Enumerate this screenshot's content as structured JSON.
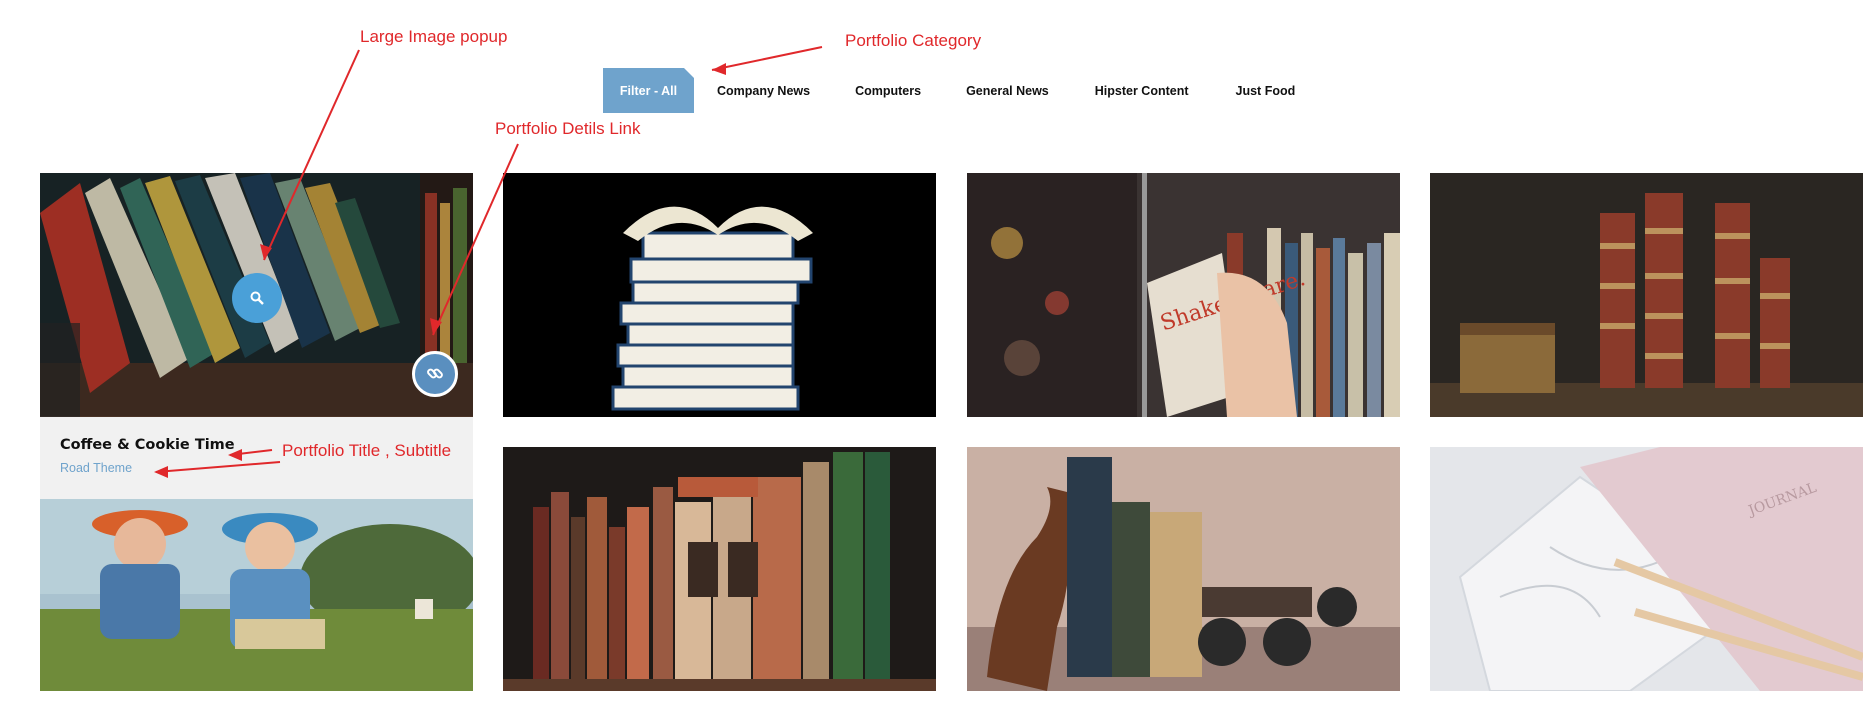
{
  "filters": {
    "items": [
      {
        "label": "Filter - All",
        "active": true
      },
      {
        "label": "Company News",
        "active": false
      },
      {
        "label": "Computers",
        "active": false
      },
      {
        "label": "General News",
        "active": false
      },
      {
        "label": "Hipster Content",
        "active": false
      },
      {
        "label": "Just Food",
        "active": false
      }
    ]
  },
  "portfolio": {
    "featured": {
      "title": "Coffee & Cookie Time",
      "subtitle": "Road Theme",
      "zoom_icon": "search-icon",
      "link_icon": "link-icon"
    },
    "tiles": [
      {
        "subject": "books-on-shelf-leaning"
      },
      {
        "subject": "stack-of-blue-books-open-book"
      },
      {
        "subject": "hand-pulling-shakespeare-book"
      },
      {
        "subject": "towers-of-old-books-with-desk"
      },
      {
        "subject": "two-boys-reading-on-grass"
      },
      {
        "subject": "old-books-on-shelf"
      },
      {
        "subject": "antique-books-with-roller-skate"
      },
      {
        "subject": "journal-notebooks-with-pencils"
      }
    ]
  },
  "annotations": {
    "large_image_popup": "Large Image popup",
    "portfolio_category": "Portfolio Category",
    "portfolio_details_link": "Portfolio Detils Link",
    "portfolio_title_subtitle": "Portfolio Title , Subtitle"
  },
  "colors": {
    "accent": "#6fa3cc",
    "annotation": "#e0282b",
    "caption_bg": "#f1f1f1"
  }
}
